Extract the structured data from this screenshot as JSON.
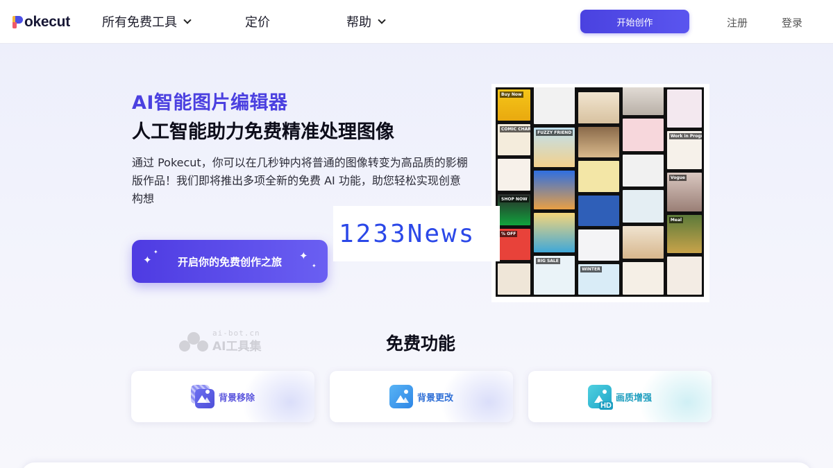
{
  "header": {
    "logo_text": "okecut",
    "nav": [
      {
        "label": "所有免费工具",
        "has_dropdown": true
      },
      {
        "label": "定价",
        "has_dropdown": false
      },
      {
        "label": "帮助",
        "has_dropdown": true
      }
    ],
    "start_button": "开始创作",
    "register": "注册",
    "login": "登录"
  },
  "hero": {
    "kicker": "AI智能图片编辑器",
    "title": "人工智能助力免费精准处理图像",
    "description": "通过 Pokecut，你可以在几秒钟内将普通的图像转变为高品质的影棚版作品！我们即将推出多项全新的免费 AI 功能，助您轻松实现创意构想",
    "cta_button": "开启你的免费创作之旅"
  },
  "watermarks": {
    "news": "1233News",
    "ai_bot_domain": "ai-bot.cn",
    "ai_bot_name": "AI工具集"
  },
  "collage": {
    "tile_labels": [
      "Buy Now",
      "COMIC CHARMS",
      "FUZZY FRIEND",
      "SHOP NOW",
      "% OFF",
      "BIG SALE",
      "WINTER",
      "Work in Progress",
      "Vogue",
      "Meal"
    ]
  },
  "features": {
    "title": "免费功能",
    "cards": [
      {
        "label": "背景移除",
        "icon": "background-remove-icon"
      },
      {
        "label": "背景更改",
        "icon": "background-change-icon"
      },
      {
        "label": "画质增强",
        "icon": "hd-enhance-icon",
        "badge": "HD"
      }
    ]
  },
  "colors": {
    "brand": "#4b40e0",
    "cta_gradient_start": "#4e3be2",
    "cta_gradient_end": "#6a5ff2",
    "page_bg": "#eceefb"
  }
}
